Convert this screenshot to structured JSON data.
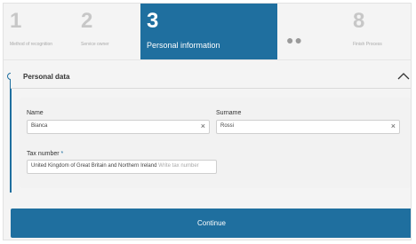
{
  "steps": [
    {
      "number": "1",
      "caption": "Method of recognition"
    },
    {
      "number": "2",
      "caption": "Service owner"
    },
    {
      "number": "3",
      "caption": "Personal information"
    },
    {
      "number": "8",
      "caption": "Finish Process"
    }
  ],
  "dots": "●●",
  "section": {
    "title": "Personal data"
  },
  "form": {
    "name_label": "Name",
    "name_value": "Bianca",
    "surname_label": "Surname",
    "surname_value": "Rossi",
    "tax_label": "Tax number",
    "tax_required_mark": "*",
    "tax_country": "United Kingdom of Great Britain and Northern Ireland",
    "tax_placeholder": "Write tax number",
    "clear_symbol": "×"
  },
  "actions": {
    "continue_label": "Continue"
  },
  "colors": {
    "accent": "#1f6f9f"
  }
}
